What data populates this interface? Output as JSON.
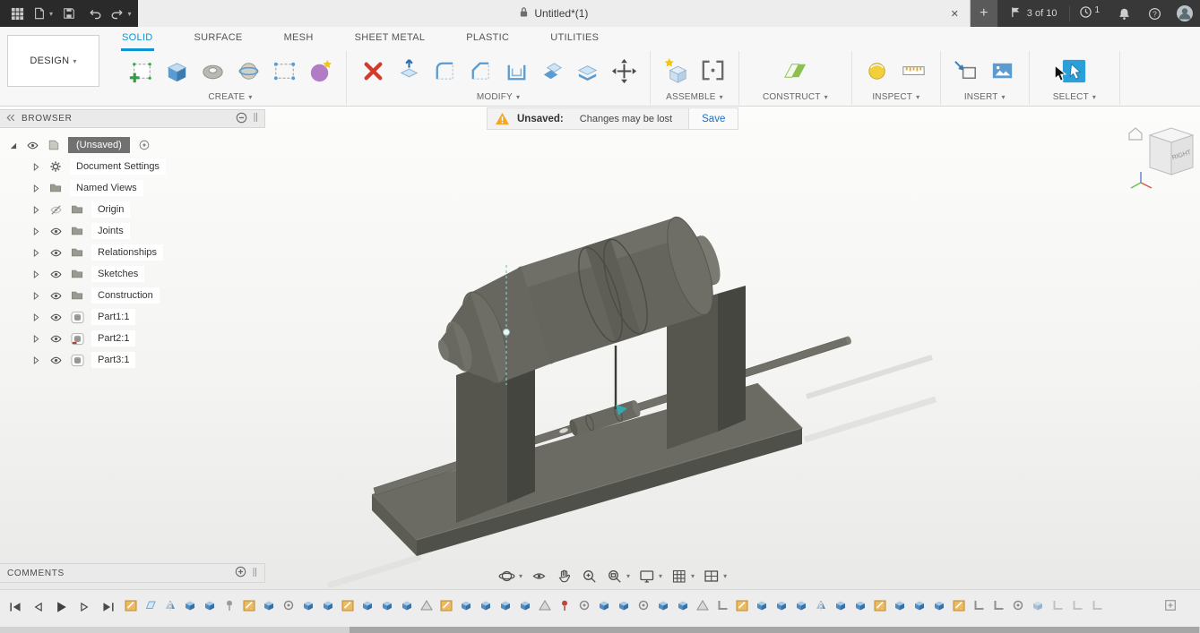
{
  "titlebar": {
    "tab_title": "Untitled*(1)",
    "documents_count": "3 of 10",
    "clock_badge": "1"
  },
  "toolbar": {
    "workspace_label": "DESIGN",
    "tabs": [
      {
        "label": "SOLID",
        "active": true
      },
      {
        "label": "SURFACE",
        "active": false
      },
      {
        "label": "MESH",
        "active": false
      },
      {
        "label": "SHEET METAL",
        "active": false
      },
      {
        "label": "PLASTIC",
        "active": false
      },
      {
        "label": "UTILITIES",
        "active": false
      }
    ],
    "groups": [
      {
        "label": "CREATE",
        "icons": [
          {
            "name": "create-sketch-icon"
          },
          {
            "name": "extrude-icon"
          },
          {
            "name": "revolve-icon"
          },
          {
            "name": "sweep-icon"
          },
          {
            "name": "rectangular-pattern-icon"
          },
          {
            "name": "create-form-icon"
          }
        ]
      },
      {
        "label": "MODIFY",
        "icons": [
          {
            "name": "delete-icon"
          },
          {
            "name": "press-pull-icon"
          },
          {
            "name": "fillet-icon"
          },
          {
            "name": "chamfer-icon"
          },
          {
            "name": "shell-icon"
          },
          {
            "name": "offset-face-icon"
          },
          {
            "name": "split-body-icon"
          },
          {
            "name": "move-copy-icon"
          }
        ]
      },
      {
        "label": "ASSEMBLE",
        "icons": [
          {
            "name": "new-component-icon"
          },
          {
            "name": "joint-icon"
          }
        ]
      },
      {
        "label": "CONSTRUCT",
        "icons": [
          {
            "name": "construction-plane-icon"
          }
        ]
      },
      {
        "label": "INSPECT",
        "icons": [
          {
            "name": "measure-icon"
          },
          {
            "name": "section-analysis-icon"
          }
        ]
      },
      {
        "label": "INSERT",
        "icons": [
          {
            "name": "insert-derive-icon"
          },
          {
            "name": "canvas-icon"
          }
        ]
      },
      {
        "label": "SELECT",
        "icons": [
          {
            "name": "select-icon",
            "active": true
          }
        ]
      }
    ]
  },
  "warning_bar": {
    "title": "Unsaved:",
    "message": "Changes may be lost",
    "action": "Save"
  },
  "browser": {
    "title": "BROWSER",
    "root_label": "(Unsaved)",
    "items": [
      {
        "label": "Document Settings",
        "icon": "gear-icon",
        "eye": null
      },
      {
        "label": "Named Views",
        "icon": "folder-icon",
        "eye": null
      },
      {
        "label": "Origin",
        "icon": "folder-icon",
        "eye": "hidden"
      },
      {
        "label": "Joints",
        "icon": "folder-icon",
        "eye": "visible"
      },
      {
        "label": "Relationships",
        "icon": "folder-icon",
        "eye": "visible"
      },
      {
        "label": "Sketches",
        "icon": "folder-icon",
        "eye": "visible"
      },
      {
        "label": "Construction",
        "icon": "folder-icon",
        "eye": "visible"
      },
      {
        "label": "Part1:1",
        "icon": "part-icon",
        "eye": "visible"
      },
      {
        "label": "Part2:1",
        "icon": "part-grounded-icon",
        "eye": "visible"
      },
      {
        "label": "Part3:1",
        "icon": "part-icon",
        "eye": "visible"
      }
    ]
  },
  "comments": {
    "title": "COMMENTS"
  },
  "viewcube": {
    "face_label": "RIGHT"
  },
  "navbar": {
    "buttons": [
      {
        "name": "orbit",
        "dropdown": true
      },
      {
        "name": "look-at",
        "dropdown": false
      },
      {
        "name": "pan",
        "dropdown": false
      },
      {
        "name": "zoom",
        "dropdown": false
      },
      {
        "name": "fit",
        "dropdown": true
      },
      {
        "name": "display-settings",
        "dropdown": true
      },
      {
        "name": "grid-settings",
        "dropdown": true
      },
      {
        "name": "viewports",
        "dropdown": true
      }
    ]
  },
  "timeline": {
    "controls": [
      "go-to-beginning",
      "step-back",
      "play",
      "step-forward",
      "go-to-end"
    ],
    "features": [
      "sketch",
      "plane",
      "mirror",
      "extrude",
      "extrude",
      "pin",
      "sketch",
      "extrude",
      "joint",
      "extrude",
      "extrude",
      "sketch",
      "extrude",
      "extrude",
      "extrude",
      "triangle",
      "sketch",
      "extrude",
      "extrude",
      "extrude",
      "extrude",
      "triangle",
      "pin-red",
      "joint",
      "extrude",
      "extrude",
      "joint",
      "extrude",
      "extrude",
      "triangle",
      "corner",
      "sketch",
      "extrude",
      "extrude",
      "extrude",
      "mirror",
      "extrude",
      "extrude",
      "sketch",
      "extrude",
      "extrude",
      "extrude",
      "sketch",
      "corner",
      "corner",
      "joint",
      "extrude",
      "corner",
      "corner",
      "corner"
    ],
    "dimmed_count": 4
  },
  "colors": {
    "accent": "#0a96d4",
    "warning": "#f5a623",
    "model_gray": "#63635b"
  }
}
